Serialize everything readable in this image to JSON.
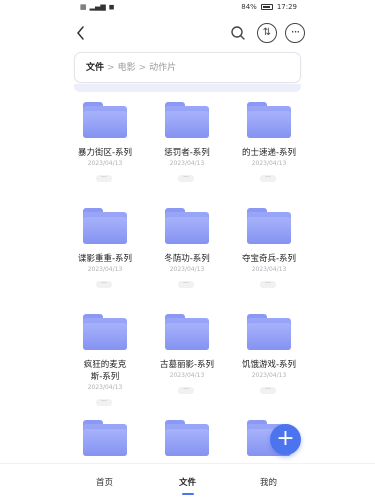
{
  "status": {
    "battery": "84%",
    "time": "17:29"
  },
  "breadcrumb": {
    "root": "文件",
    "sep1": ">",
    "level1": "电影",
    "sep2": ">",
    "level2": "动作片"
  },
  "folders": [
    {
      "name": "暴力街区-系列",
      "date": "2023/04/13"
    },
    {
      "name": "惩罚者-系列",
      "date": "2023/04/13"
    },
    {
      "name": "的士速递-系列",
      "date": "2023/04/13"
    },
    {
      "name": "谍影重重-系列",
      "date": "2023/04/13"
    },
    {
      "name": "冬荫功-系列",
      "date": "2023/04/13"
    },
    {
      "name": "夺宝奇兵-系列",
      "date": "2023/04/13"
    },
    {
      "name": "疯狂的麦克斯-系列",
      "date": "2023/04/13"
    },
    {
      "name": "古墓丽影-系列",
      "date": "2023/04/13"
    },
    {
      "name": "饥饿游戏-系列",
      "date": "2023/04/13"
    }
  ],
  "more_label": "···",
  "fab_label": "+",
  "nav": {
    "home": "首页",
    "files": "文件",
    "mine": "我的"
  },
  "colors": {
    "accent": "#4b74ee",
    "folder": "#8b98f4"
  }
}
